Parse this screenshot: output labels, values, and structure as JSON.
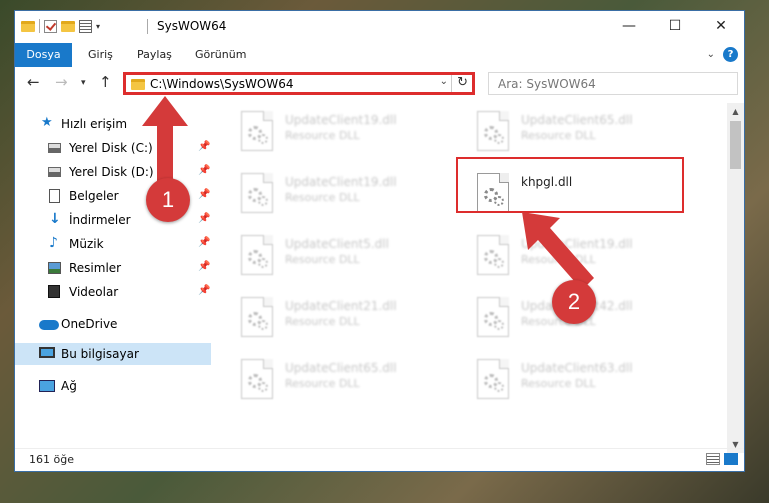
{
  "window": {
    "title": "SysWOW64",
    "controls": {
      "minimize": "—",
      "maximize": "☐",
      "close": "✕"
    }
  },
  "ribbon": {
    "tabs": [
      "Dosya",
      "Giriş",
      "Paylaş",
      "Görünüm"
    ]
  },
  "address": {
    "path": "C:\\Windows\\SysWOW64",
    "search_placeholder": "Ara: SysWOW64"
  },
  "sidebar": {
    "items": [
      {
        "label": "Hızlı erişim",
        "icon": "star-icon"
      },
      {
        "label": "Yerel Disk (C:)",
        "icon": "drive-icon",
        "pinned": true
      },
      {
        "label": "Yerel Disk (D:)",
        "icon": "drive-icon",
        "pinned": true
      },
      {
        "label": "Belgeler",
        "icon": "document-icon",
        "pinned": true
      },
      {
        "label": "İndirmeler",
        "icon": "download-icon",
        "pinned": true
      },
      {
        "label": "Müzik",
        "icon": "music-icon",
        "pinned": true
      },
      {
        "label": "Resimler",
        "icon": "pictures-icon",
        "pinned": true
      },
      {
        "label": "Videolar",
        "icon": "videos-icon",
        "pinned": true
      },
      {
        "label": "OneDrive",
        "icon": "cloud-icon"
      },
      {
        "label": "Bu bilgisayar",
        "icon": "computer-icon",
        "selected": true
      },
      {
        "label": "Ağ",
        "icon": "network-icon"
      }
    ]
  },
  "files": [
    {
      "name": "UpdateClient19.dll",
      "type": "Resource DLL"
    },
    {
      "name": "UpdateClient65.dll",
      "type": "Resource DLL"
    },
    {
      "name": "UpdateClient19.dll",
      "type": "Resource DLL"
    },
    {
      "name": "khpgl.dll",
      "type": ""
    },
    {
      "name": "UpdateClient5.dll",
      "type": "Resource DLL"
    },
    {
      "name": "UpdateClient19.dll",
      "type": "Resource DLL"
    },
    {
      "name": "UpdateClient21.dll",
      "type": "Resource DLL"
    },
    {
      "name": "UpdateClient42.dll",
      "type": "Resource DLL"
    },
    {
      "name": "UpdateClient65.dll",
      "type": "Resource DLL"
    },
    {
      "name": "UpdateClient63.dll",
      "type": "Resource DLL"
    }
  ],
  "status": {
    "count": "161 öğe"
  },
  "annotations": {
    "step1": "1",
    "step2": "2"
  },
  "colors": {
    "accent": "#1979ca",
    "annotation_red": "#dd2d2d"
  }
}
